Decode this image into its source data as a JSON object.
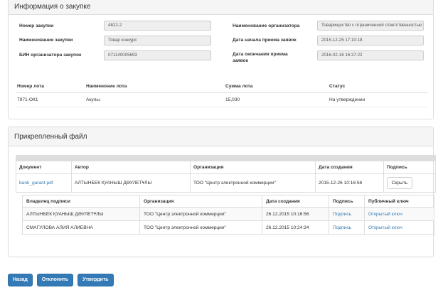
{
  "info": {
    "title": "Информация о закупке",
    "fields": {
      "number_label": "Номер закупки",
      "number_value": "4822-2",
      "name_label": "Наименование закупки",
      "name_value": "Товар конкурс",
      "bin_label": "БИН организатора закупок",
      "bin_value": "071140005693",
      "org_label": "Наименование организатора",
      "org_value": "Товарищество с ограниченной ответственностью",
      "start_label": "Дата начала приема заявок",
      "start_value": "2015-12-25 17:10:18",
      "end_label": "Дата окончания приема заявок",
      "end_value": "2016-02-16 16:37:22"
    },
    "lots": {
      "headers": [
        "Номер лота",
        "Наименоние лота",
        "Сумма лота",
        "Статус"
      ],
      "rows": [
        [
          "7971-ОК1",
          "Акулы.",
          "15,030",
          "На утверждении"
        ]
      ]
    }
  },
  "files": {
    "title": "Прикрепленный файл",
    "headers": [
      "Документ",
      "Автор",
      "Организация",
      "Дата создания",
      "Подпись"
    ],
    "row": {
      "document": "bank_garant.pdf",
      "author": "АЛТЫНБЕК ҚУАНЫШ ДӘУЛЕТҰЛЫ",
      "organization": "ТОО \"Центр электронной коммерции\"",
      "date": "2015-12-26 10:16:56",
      "hide_label": "Скрыть"
    },
    "signatures": {
      "headers": [
        "Владелец подписи",
        "Организация",
        "Дата создания",
        "Подпись",
        "Публичный ключ"
      ],
      "rows": [
        [
          "АЛТЫНБЕК ҚУАНЫШ ДӘУЛЕТҰЛЫ",
          "ТОО \"Центр электронной коммерции\"",
          "26.12.2015 10:16:56",
          "Подпись",
          "Открытый ключ"
        ],
        [
          "СМАГУЛОВА АЛИЯ АЛИЕВНА",
          "ТОО \"Центр электронной коммерции\"",
          "26.12.2015 10:24:34",
          "Подпись",
          "Открытый ключ"
        ]
      ]
    }
  },
  "actions": {
    "back": "Назад",
    "reject": "Отклонить",
    "approve": "Утвердить"
  }
}
